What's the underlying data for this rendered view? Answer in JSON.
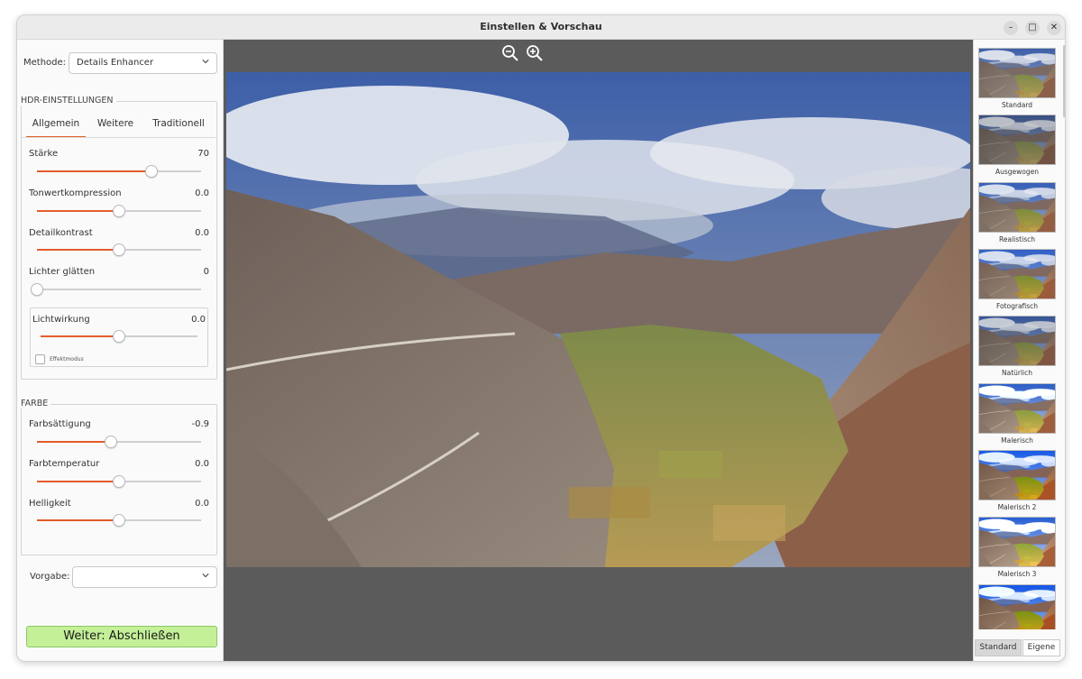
{
  "window": {
    "title": "Einstellen & Vorschau"
  },
  "method": {
    "label": "Methode:",
    "value": "Details Enhancer"
  },
  "hdr": {
    "title": "HDR-EINSTELLUNGEN",
    "tabs": [
      {
        "label": "Allgemein",
        "active": true
      },
      {
        "label": "Weitere",
        "active": false
      },
      {
        "label": "Traditionell",
        "active": false
      }
    ],
    "sliders": [
      {
        "label": "Stärke",
        "value": "70",
        "level": 0.7
      },
      {
        "label": "Tonwertkompression",
        "value": "0.0",
        "level": 0.5
      },
      {
        "label": "Detailkontrast",
        "value": "0.0",
        "level": 0.5
      },
      {
        "label": "Lichter glätten",
        "value": "0",
        "level": 0.0
      }
    ],
    "light": {
      "label": "Lichtwirkung",
      "value": "0.0",
      "level": 0.5,
      "checkbox_label": "Effektmodus",
      "checked": false
    }
  },
  "color": {
    "title": "FARBE",
    "sliders": [
      {
        "label": "Farbsättigung",
        "value": "-0.9",
        "level": 0.45
      },
      {
        "label": "Farbtemperatur",
        "value": "0.0",
        "level": 0.5
      },
      {
        "label": "Helligkeit",
        "value": "0.0",
        "level": 0.5
      }
    ]
  },
  "preset": {
    "label": "Vorgabe:",
    "value": ""
  },
  "next_button": "Weiter: Abschließen",
  "zoom": {
    "out_icon": "zoom-out-icon",
    "in_icon": "zoom-in-icon"
  },
  "presets_panel": {
    "thumbnails": [
      "Standard",
      "Ausgewogen",
      "Realistisch",
      "Fotografisch",
      "Natürlich",
      "Malerisch",
      "Malerisch 2",
      "Malerisch 3",
      ""
    ],
    "tabs": [
      {
        "label": "Standard",
        "active": true
      },
      {
        "label": "Eigene",
        "active": false
      }
    ]
  },
  "colors": {
    "accent": "#e35c2b",
    "primary_button": "#c4f098",
    "preview_background": "#5b5b5b"
  }
}
